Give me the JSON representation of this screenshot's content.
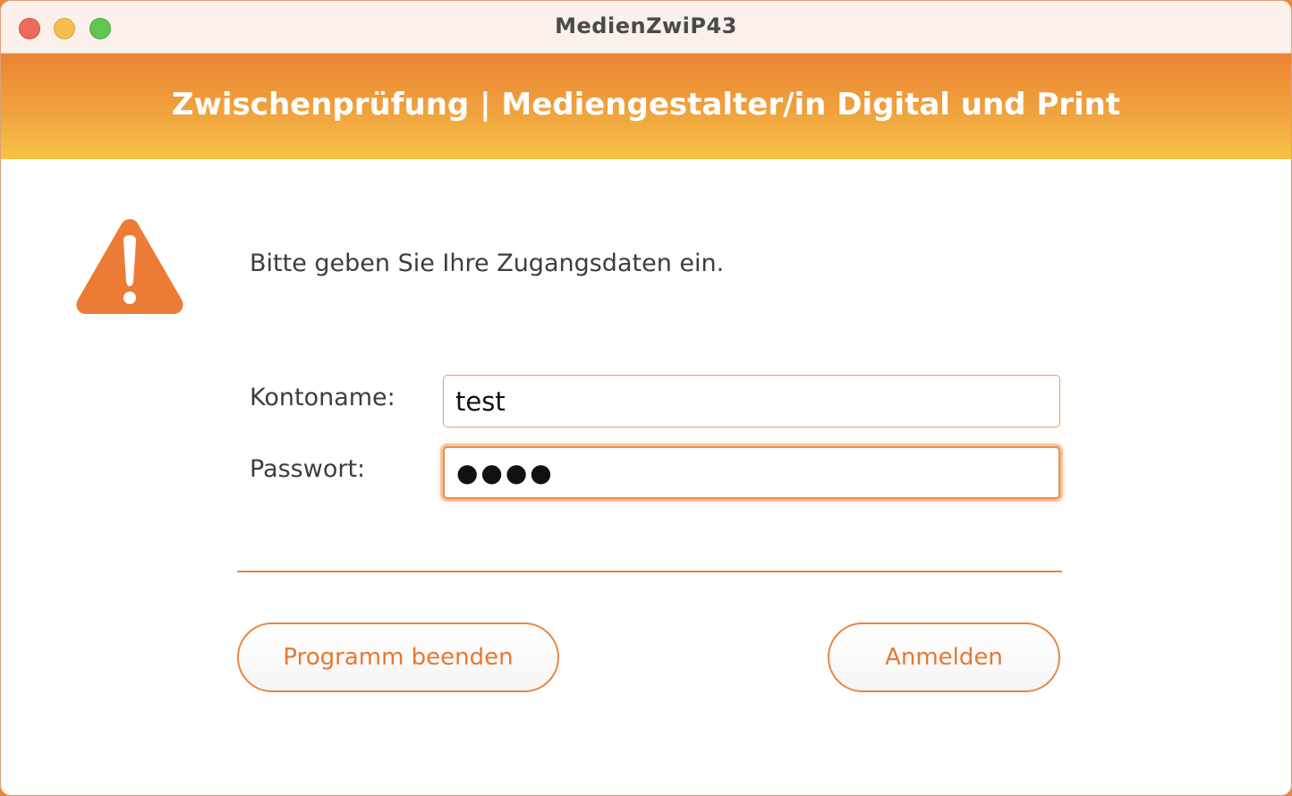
{
  "window": {
    "title": "MedienZwiP43"
  },
  "banner": {
    "title": "Zwischenprüfung | Mediengestalter/in Digital und Print"
  },
  "dialog": {
    "icon": "warning-icon",
    "prompt": "Bitte geben Sie Ihre Zugangsdaten ein."
  },
  "form": {
    "account_label": "Kontoname:",
    "account_value": "test",
    "password_label": "Passwort:",
    "password_masked": "●●●●"
  },
  "buttons": {
    "quit_label": "Programm beenden",
    "login_label": "Anmelden"
  },
  "colors": {
    "accent": "#e9853f",
    "banner_top": "#ec8333",
    "banner_bottom": "#f6c245"
  }
}
